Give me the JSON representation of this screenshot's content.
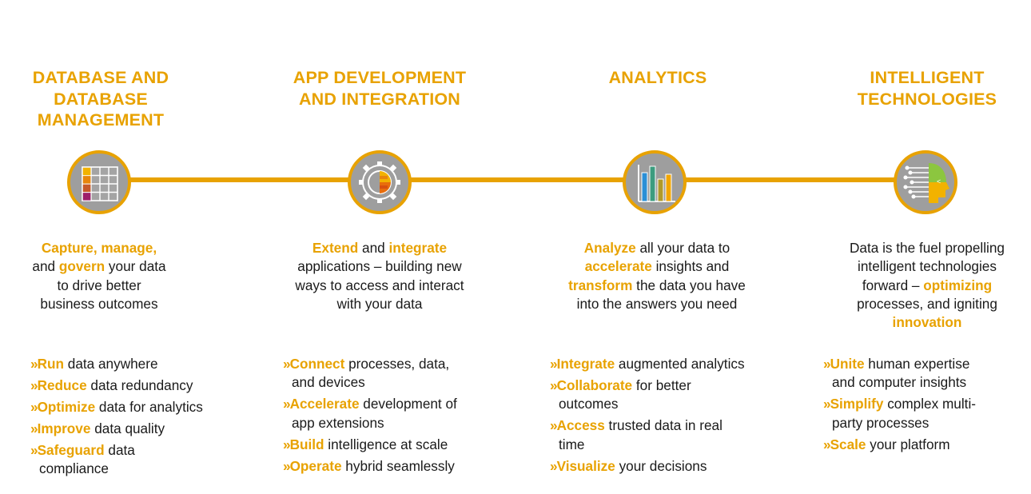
{
  "colors": {
    "accent": "#e8a201",
    "node_fill": "#9e9e9e",
    "text": "#1a1a1a"
  },
  "columns": [
    {
      "id": "database",
      "title": "DATABASE AND\nDATABASE\nMANAGEMENT",
      "icon": "database-table-icon",
      "description": [
        {
          "t": "Capture, manage,",
          "h": true
        },
        {
          "t": "\n"
        },
        {
          "t": "and "
        },
        {
          "t": "govern",
          "h": true
        },
        {
          "t": " your data"
        },
        {
          "t": "\n"
        },
        {
          "t": "to drive better"
        },
        {
          "t": "\n"
        },
        {
          "t": "business outcomes"
        }
      ],
      "bullets": [
        [
          {
            "t": "Run",
            "h": true
          },
          {
            "t": " data anywhere"
          }
        ],
        [
          {
            "t": "Reduce",
            "h": true
          },
          {
            "t": " data redundancy"
          }
        ],
        [
          {
            "t": "Optimize",
            "h": true
          },
          {
            "t": " data for analytics"
          }
        ],
        [
          {
            "t": "Improve",
            "h": true
          },
          {
            "t": " data quality"
          }
        ],
        [
          {
            "t": "Safeguard",
            "h": true
          },
          {
            "t": " data"
          },
          {
            "t": "\n"
          },
          {
            "t": "compliance"
          }
        ]
      ]
    },
    {
      "id": "appdev",
      "title": "APP DEVELOPMENT\nAND INTEGRATION",
      "icon": "gear-icon",
      "description": [
        {
          "t": "Extend",
          "h": true
        },
        {
          "t": " and "
        },
        {
          "t": "integrate",
          "h": true
        },
        {
          "t": "\n"
        },
        {
          "t": "applications – building new"
        },
        {
          "t": "\n"
        },
        {
          "t": "ways to access and interact"
        },
        {
          "t": "\n"
        },
        {
          "t": "with your data"
        }
      ],
      "bullets": [
        [
          {
            "t": "Connect",
            "h": true
          },
          {
            "t": "  processes, data,"
          },
          {
            "t": "\n"
          },
          {
            "t": "and devices"
          }
        ],
        [
          {
            "t": "Accelerate",
            "h": true
          },
          {
            "t": " development of"
          },
          {
            "t": "\n"
          },
          {
            "t": "app extensions"
          }
        ],
        [
          {
            "t": "Build",
            "h": true
          },
          {
            "t": " intelligence at scale"
          }
        ],
        [
          {
            "t": "Operate",
            "h": true
          },
          {
            "t": " hybrid seamlessly"
          }
        ]
      ]
    },
    {
      "id": "analytics",
      "title": "ANALYTICS",
      "icon": "bar-chart-icon",
      "description": [
        {
          "t": "Analyze",
          "h": true
        },
        {
          "t": " all your data to"
        },
        {
          "t": "\n"
        },
        {
          "t": "accelerate",
          "h": true
        },
        {
          "t": " insights and"
        },
        {
          "t": "\n"
        },
        {
          "t": "transform",
          "h": true
        },
        {
          "t": " the data you have"
        },
        {
          "t": "\n"
        },
        {
          "t": "into the answers you need"
        }
      ],
      "bullets": [
        [
          {
            "t": "Integrate",
            "h": true
          },
          {
            "t": " augmented analytics"
          }
        ],
        [
          {
            "t": "Collaborate",
            "h": true
          },
          {
            "t": " for better"
          },
          {
            "t": "\n"
          },
          {
            "t": "outcomes"
          }
        ],
        [
          {
            "t": "Access",
            "h": true
          },
          {
            "t": " trusted data in real"
          },
          {
            "t": "\n"
          },
          {
            "t": "time"
          }
        ],
        [
          {
            "t": "Visualize",
            "h": true
          },
          {
            "t": " your decisions"
          }
        ]
      ]
    },
    {
      "id": "intelligent",
      "title": "INTELLIGENT\nTECHNOLOGIES",
      "icon": "ai-head-icon",
      "description": [
        {
          "t": "Data is the fuel propelling"
        },
        {
          "t": "\n"
        },
        {
          "t": "intelligent technologies"
        },
        {
          "t": "\n"
        },
        {
          "t": "forward – "
        },
        {
          "t": "optimizing",
          "h": true
        },
        {
          "t": "\n"
        },
        {
          "t": "processes, and igniting"
        },
        {
          "t": "\n"
        },
        {
          "t": "innovation",
          "h": true
        }
      ],
      "bullets": [
        [
          {
            "t": "Unite",
            "h": true
          },
          {
            "t": " human expertise"
          },
          {
            "t": "\n"
          },
          {
            "t": "and computer insights"
          }
        ],
        [
          {
            "t": "Simplify",
            "h": true
          },
          {
            "t": " complex multi-"
          },
          {
            "t": "\n"
          },
          {
            "t": "party processes"
          }
        ],
        [
          {
            "t": "Scale",
            "h": true
          },
          {
            "t": " your platform"
          }
        ]
      ]
    }
  ]
}
